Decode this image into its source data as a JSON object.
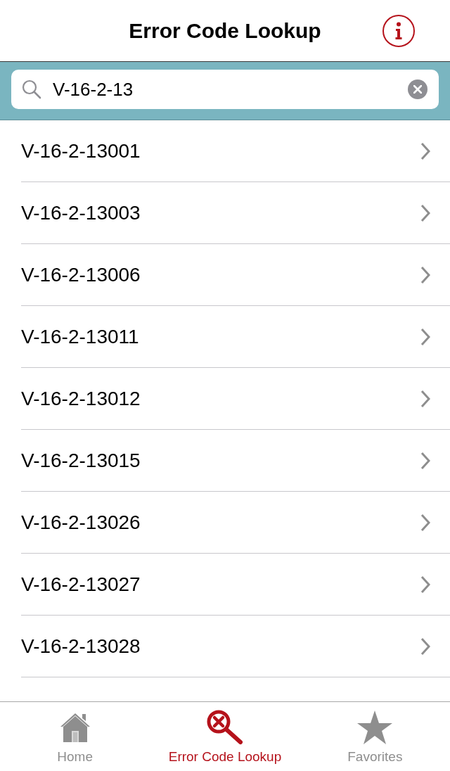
{
  "header": {
    "title": "Error Code Lookup"
  },
  "search": {
    "value": "V-16-2-13"
  },
  "results": [
    {
      "code": "V-16-2-13001"
    },
    {
      "code": "V-16-2-13003"
    },
    {
      "code": "V-16-2-13006"
    },
    {
      "code": "V-16-2-13011"
    },
    {
      "code": "V-16-2-13012"
    },
    {
      "code": "V-16-2-13015"
    },
    {
      "code": "V-16-2-13026"
    },
    {
      "code": "V-16-2-13027"
    },
    {
      "code": "V-16-2-13028"
    }
  ],
  "tab_bar": {
    "tabs": [
      {
        "kind": "home",
        "label": "Home",
        "selected": false
      },
      {
        "kind": "lookup",
        "label": "Error Code Lookup",
        "selected": true
      },
      {
        "kind": "favorites",
        "label": "Favorites",
        "selected": false
      }
    ]
  }
}
